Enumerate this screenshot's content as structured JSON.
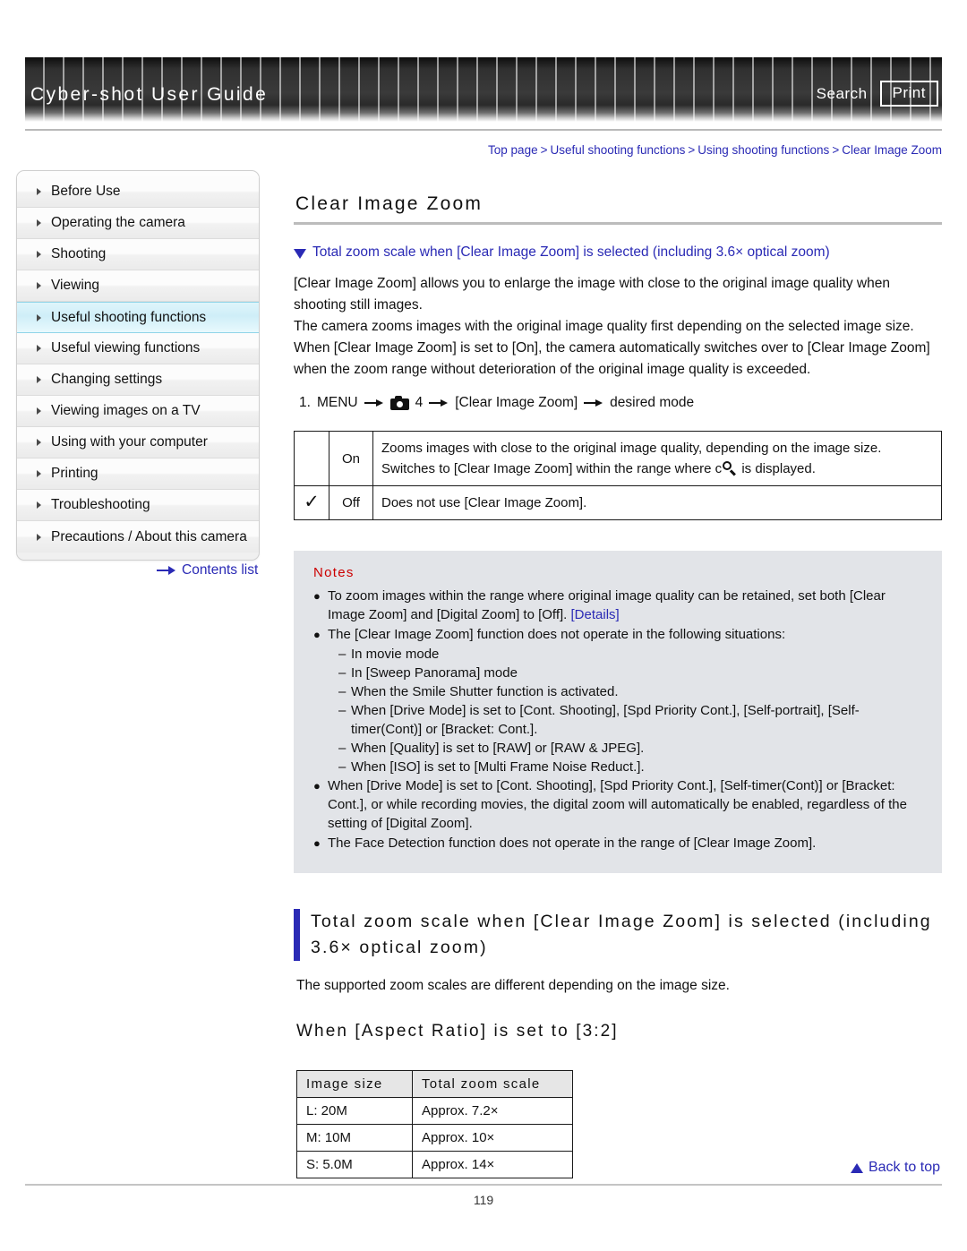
{
  "header": {
    "title": "Cyber-shot User Guide",
    "search_label": "Search",
    "print_label": "Print"
  },
  "sidebar": {
    "items": [
      {
        "label": "Before Use",
        "active": false
      },
      {
        "label": "Operating the camera",
        "active": false
      },
      {
        "label": "Shooting",
        "active": false
      },
      {
        "label": "Viewing",
        "active": false
      },
      {
        "label": "Useful shooting functions",
        "active": true
      },
      {
        "label": "Useful viewing functions",
        "active": false
      },
      {
        "label": "Changing settings",
        "active": false
      },
      {
        "label": "Viewing images on a TV",
        "active": false
      },
      {
        "label": "Using with your computer",
        "active": false
      },
      {
        "label": "Printing",
        "active": false
      },
      {
        "label": "Troubleshooting",
        "active": false
      },
      {
        "label": "Precautions / About this camera",
        "active": false
      }
    ],
    "contents_list_label": "Contents list"
  },
  "breadcrumb": {
    "items": [
      "Top page",
      "Useful shooting functions",
      "Using shooting functions",
      "Clear Image Zoom"
    ],
    "separator": ">"
  },
  "main": {
    "page_title": "Clear Image Zoom",
    "jump_link_label": "Total zoom scale when [Clear Image Zoom] is selected (including 3.6× optical zoom)",
    "paragraphs": [
      "[Clear Image Zoom] allows you to enlarge the image with close to the original image quality when shooting still images.",
      "The camera zooms images with the original image quality first depending on the selected image size.",
      "When [Clear Image Zoom] is set to [On], the camera automatically switches over to [Clear Image Zoom] when the zoom range without deterioration of the original image quality is exceeded."
    ],
    "menu_step": {
      "number": "1.",
      "menu_label": "MENU",
      "tab_number": "4",
      "setting_label": "[Clear Image Zoom]",
      "result_label": "desired mode"
    },
    "options_table": [
      {
        "checked": "",
        "option": "On",
        "description_line1": "Zooms images with close to the original image quality, depending on the image size.",
        "description_line2_before": "Switches to [Clear Image Zoom] within the range where c",
        "description_line2_after": "is displayed."
      },
      {
        "checked": "✓",
        "option": "Off",
        "description_line1": "Does not use [Clear Image Zoom].",
        "description_line2_before": "",
        "description_line2_after": ""
      }
    ],
    "notes": {
      "title": "Notes",
      "items": [
        {
          "bullet": "●",
          "text_before": "To zoom images within the range where original image quality can be retained, set both [Clear Image Zoom] and [Digital Zoom] to [Off].",
          "link": "[Details]",
          "subs": []
        },
        {
          "bullet": "●",
          "text_before": "The [Clear Image Zoom] function does not operate in the following situations:",
          "link": "",
          "subs": [
            "In movie mode",
            "In [Sweep Panorama] mode",
            "When the Smile Shutter function is activated.",
            "When [Drive Mode] is set to [Cont. Shooting], [Spd Priority Cont.], [Self-portrait], [Self-timer(Cont)] or [Bracket: Cont.].",
            "When [Quality] is set to [RAW] or [RAW & JPEG].",
            "When [ISO] is set to [Multi Frame Noise Reduct.]."
          ]
        },
        {
          "bullet": "●",
          "text_before": "When [Drive Mode] is set to [Cont. Shooting], [Spd Priority Cont.], [Self-timer(Cont)] or [Bracket: Cont.], or while recording movies, the digital zoom will automatically be enabled, regardless of the setting of [Digital Zoom].",
          "link": "",
          "subs": []
        },
        {
          "bullet": "●",
          "text_before": "The Face Detection function does not operate in the range of [Clear Image Zoom].",
          "link": "",
          "subs": []
        }
      ]
    },
    "section2": {
      "heading": "Total zoom scale when [Clear Image Zoom] is selected (including 3.6× optical zoom)",
      "description": "The supported zoom scales are different depending on the image size.",
      "aspect_heading": "When [Aspect Ratio] is set to [3:2]"
    }
  },
  "chart_data": {
    "type": "table",
    "title": "When [Aspect Ratio] is set to [3:2]",
    "columns": [
      "Image size",
      "Total zoom scale"
    ],
    "rows": [
      [
        "L: 20M",
        "Approx. 7.2×"
      ],
      [
        "M: 10M",
        "Approx. 10×"
      ],
      [
        "S: 5.0M",
        "Approx. 14×"
      ]
    ]
  },
  "footer": {
    "back_to_top_label": "Back to top",
    "page_number": "119"
  }
}
